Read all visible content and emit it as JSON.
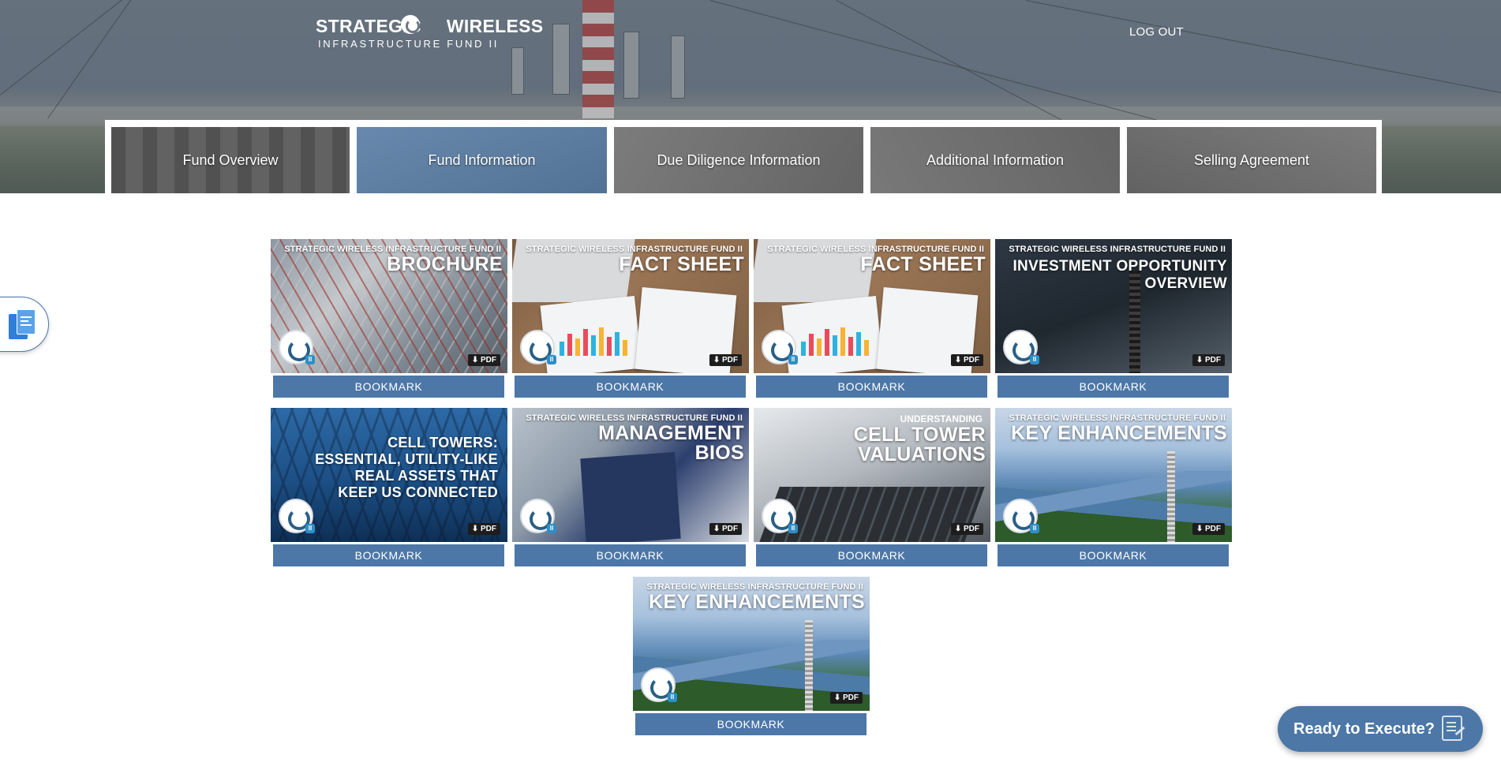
{
  "header": {
    "logo_line1": "STRATEGIC WIRELESS",
    "logo_line1_a": "STRATEGIC",
    "logo_line1_b": "WIRELESS",
    "logo_line2": "INFRASTRUCTURE FUND II",
    "logout_label": "LOG OUT"
  },
  "tabs": [
    {
      "label": "Fund Overview",
      "active": false
    },
    {
      "label": "Fund Information",
      "active": true
    },
    {
      "label": "Due Diligence Information",
      "active": false
    },
    {
      "label": "Additional Information",
      "active": false
    },
    {
      "label": "Selling Agreement",
      "active": false
    }
  ],
  "documents": [
    {
      "series": "STRATEGIC WIRELESS INFRASTRUCTURE FUND II",
      "title": "BROCHURE",
      "format": "PDF",
      "action": "BOOKMARK"
    },
    {
      "series": "STRATEGIC WIRELESS INFRASTRUCTURE FUND II",
      "title": "FACT SHEET",
      "format": "PDF",
      "action": "BOOKMARK"
    },
    {
      "series": "STRATEGIC WIRELESS INFRASTRUCTURE FUND II",
      "title": "FACT SHEET",
      "format": "PDF",
      "action": "BOOKMARK"
    },
    {
      "series": "STRATEGIC WIRELESS INFRASTRUCTURE FUND II",
      "title_line1": "INVESTMENT OPPORTUNITY",
      "title_line2": "OVERVIEW",
      "format": "PDF",
      "action": "BOOKMARK"
    },
    {
      "title_line1": "CELL TOWERS:",
      "title_line2": "ESSENTIAL, UTILITY-LIKE",
      "title_line3": "REAL ASSETS THAT",
      "title_line4": "KEEP US CONNECTED",
      "format": "PDF",
      "action": "BOOKMARK"
    },
    {
      "series": "STRATEGIC WIRELESS INFRASTRUCTURE FUND II",
      "title_line1": "MANAGEMENT",
      "title_line2": "BIOS",
      "format": "PDF",
      "action": "BOOKMARK"
    },
    {
      "kicker": "UNDERSTANDING",
      "title_line1": "CELL TOWER",
      "title_line2": "VALUATIONS",
      "format": "PDF",
      "action": "BOOKMARK"
    },
    {
      "series": "STRATEGIC WIRELESS INFRASTRUCTURE FUND II",
      "title": "KEY ENHANCEMENTS",
      "format": "PDF",
      "action": "BOOKMARK"
    },
    {
      "series": "STRATEGIC WIRELESS INFRASTRUCTURE FUND II",
      "title": "KEY ENHANCEMENTS",
      "format": "PDF",
      "action": "BOOKMARK"
    }
  ],
  "cta": {
    "label": "Ready to Execute?"
  },
  "colors": {
    "accent": "#4c77a7",
    "active_tab": "#5b7fa6",
    "badge": "#2d8fc8"
  },
  "icons": {
    "side_tool": "documents-icon",
    "cta": "signature-document-icon",
    "pdf": "download-icon"
  }
}
